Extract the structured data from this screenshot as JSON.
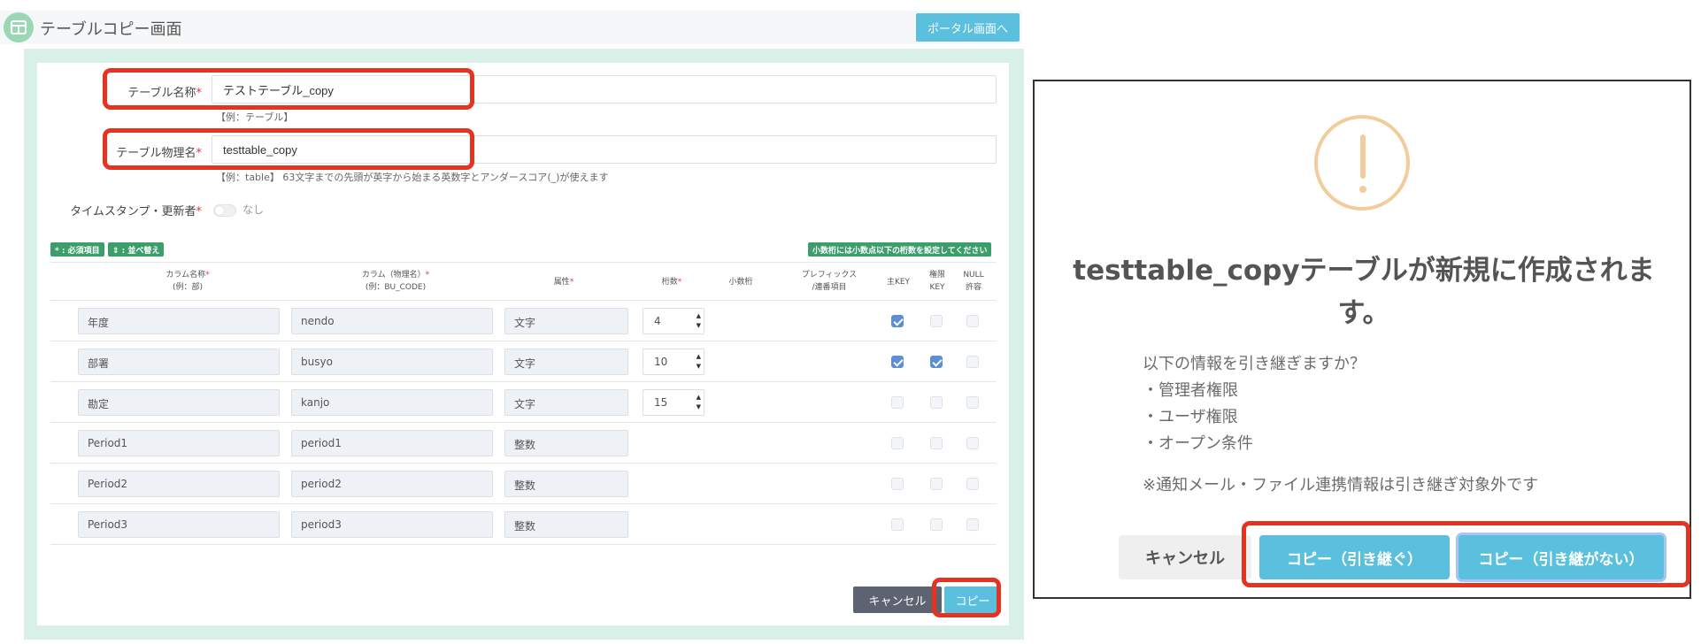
{
  "app": {
    "title": "テーブルコピー画面",
    "portal_button": "ポータル画面へ"
  },
  "form": {
    "table_name": {
      "label": "テーブル名称",
      "required_mark": "*",
      "value": "テストテーブル_copy",
      "hint": "【例：テーブル】"
    },
    "physical_name": {
      "label": "テーブル物理名",
      "required_mark": "*",
      "value": "testtable_copy",
      "hint": "【例：table】 63文字までの先頭が英字から始まる英数字とアンダースコア(_)が使えます"
    },
    "timestamp": {
      "label": "タイムスタンプ・更新者",
      "required_mark": "*",
      "toggle_on": false,
      "value_label": "なし"
    }
  },
  "legend": {
    "required_tag": "* : 必須項目",
    "sort_tag": "⇕ : 並べ替え",
    "decimal_note": "小数桁には小数点以下の桁数を設定してください"
  },
  "table": {
    "headers": {
      "col_name": "カラム名称",
      "col_name_example": "(例：部)",
      "col_physical": "カラム（物理名）",
      "col_physical_example": "(例：BU_CODE)",
      "attribute": "属性",
      "digits": "桁数",
      "decimal": "小数桁",
      "prefix_line1": "プレフィックス",
      "prefix_line2": "/連番項目",
      "main_key": "主KEY",
      "auth_key_line1": "権限",
      "auth_key_line2": "KEY",
      "null_line1": "NULL",
      "null_line2": "許容",
      "required_mark": "*"
    },
    "rows": [
      {
        "name": "年度",
        "physical": "nendo",
        "attribute": "文字",
        "digits": "4",
        "main_key": true,
        "auth_key": false,
        "null_ok": false
      },
      {
        "name": "部署",
        "physical": "busyo",
        "attribute": "文字",
        "digits": "10",
        "main_key": true,
        "auth_key": true,
        "null_ok": false
      },
      {
        "name": "勘定",
        "physical": "kanjo",
        "attribute": "文字",
        "digits": "15",
        "main_key": false,
        "auth_key": false,
        "null_ok": false
      },
      {
        "name": "Period1",
        "physical": "period1",
        "attribute": "整数",
        "digits": "",
        "main_key": false,
        "auth_key": false,
        "null_ok": false
      },
      {
        "name": "Period2",
        "physical": "period2",
        "attribute": "整数",
        "digits": "",
        "main_key": false,
        "auth_key": false,
        "null_ok": false
      },
      {
        "name": "Period3",
        "physical": "period3",
        "attribute": "整数",
        "digits": "",
        "main_key": false,
        "auth_key": false,
        "null_ok": false
      }
    ]
  },
  "footer": {
    "cancel": "キャンセル",
    "copy": "コピー"
  },
  "dialog": {
    "title": "testtable_copyテーブルが新規に作成されます。",
    "question": "以下の情報を引き継ぎますか？",
    "items": [
      "・管理者権限",
      "・ユーザ権限",
      "・オープン条件"
    ],
    "note": "※通知メール・ファイル連携情報は引き継ぎ対象外です",
    "cancel": "キャンセル",
    "copy_keep": "コピー（引き継ぐ）",
    "copy_nokeep": "コピー（引き継がない）"
  },
  "colors": {
    "accent": "#5bc0de",
    "highlight": "#e53322",
    "tag_green": "#3b9e6b",
    "checked_blue": "#5a8fd6",
    "warning": "#f3cc9d"
  }
}
